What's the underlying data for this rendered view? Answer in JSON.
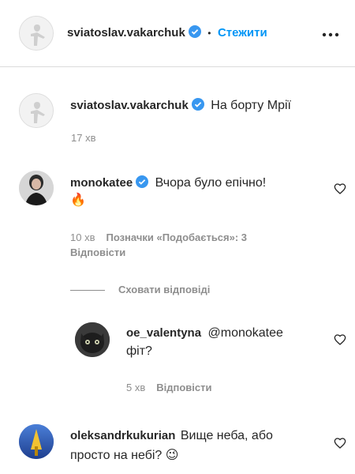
{
  "header": {
    "username": "sviatoslav.vakarchuk",
    "separator": "•",
    "follow_label": "Стежити",
    "more_icon": "more-horizontal-icon"
  },
  "caption": {
    "username": "sviatoslav.vakarchuk",
    "text": "На борту Мрії",
    "time": "17 хв"
  },
  "comments": [
    {
      "username": "monokatee",
      "verified": true,
      "text": "Вчора було епічно!",
      "emoji": "🔥",
      "time": "10 хв",
      "likes": "Позначки «Подобається»: 3",
      "reply": "Відповісти",
      "hide_replies": "Сховати відповіді"
    },
    {
      "username": "oe_valentyna",
      "mention": "@monokatee",
      "text": "фіт?",
      "time": "5 хв",
      "reply": "Відповісти"
    },
    {
      "username": "oleksandrkukurian",
      "text_line1": "Вище неба, або",
      "text_line2": "просто на небі?",
      "emoji": "😉"
    }
  ],
  "colors": {
    "verified": "#3897f0",
    "follow": "#0095f6",
    "text": "#262626",
    "secondary": "#8e8e8e"
  }
}
